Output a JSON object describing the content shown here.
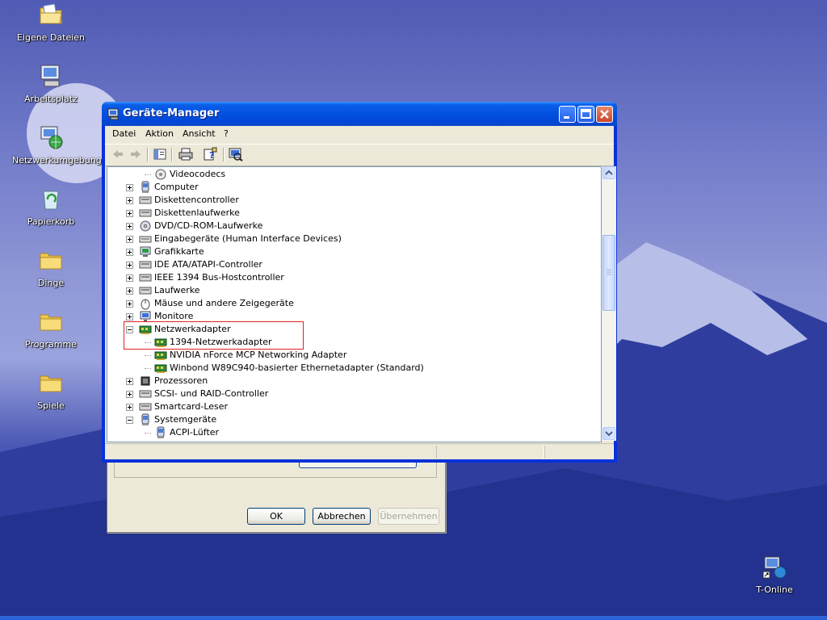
{
  "desktop": {
    "icons": [
      {
        "label": "Eigene Dateien",
        "icon": "my-documents-icon"
      },
      {
        "label": "Arbeitsplatz",
        "icon": "my-computer-icon"
      },
      {
        "label": "Netzwerkumgebung",
        "icon": "network-places-icon"
      },
      {
        "label": "Papierkorb",
        "icon": "recycle-bin-icon"
      },
      {
        "label": "Dinge",
        "icon": "folder-icon"
      },
      {
        "label": "Programme",
        "icon": "folder-icon"
      },
      {
        "label": "Spiele",
        "icon": "folder-icon"
      },
      {
        "label": "T-Online",
        "icon": "t-online-shortcut-icon"
      }
    ]
  },
  "background_dialog": {
    "ok_label": "OK",
    "cancel_label": "Abbrechen",
    "apply_label": "Übernehmen"
  },
  "window": {
    "title": "Geräte-Manager",
    "menu": [
      "Datei",
      "Aktion",
      "Ansicht",
      "?"
    ],
    "toolbar_icons": [
      "back-arrow-icon",
      "forward-arrow-icon",
      "show-hide-tree-icon",
      "print-icon",
      "properties-help-icon",
      "scan-hardware-icon"
    ]
  },
  "tree": [
    {
      "label": "Videocodecs",
      "level": 1,
      "icon": "codec-icon"
    },
    {
      "label": "Computer",
      "level": 0,
      "expander": "+",
      "icon": "computer-icon"
    },
    {
      "label": "Diskettencontroller",
      "level": 0,
      "expander": "+",
      "icon": "floppy-controller-icon"
    },
    {
      "label": "Diskettenlaufwerke",
      "level": 0,
      "expander": "+",
      "icon": "floppy-drive-icon"
    },
    {
      "label": "DVD/CD-ROM-Laufwerke",
      "level": 0,
      "expander": "+",
      "icon": "cdrom-icon"
    },
    {
      "label": "Eingabegeräte (Human Interface Devices)",
      "level": 0,
      "expander": "+",
      "icon": "hid-icon"
    },
    {
      "label": "Grafikkarte",
      "level": 0,
      "expander": "+",
      "icon": "display-adapter-icon"
    },
    {
      "label": "IDE ATA/ATAPI-Controller",
      "level": 0,
      "expander": "+",
      "icon": "ide-controller-icon"
    },
    {
      "label": "IEEE 1394 Bus-Hostcontroller",
      "level": 0,
      "expander": "+",
      "icon": "ieee1394-icon"
    },
    {
      "label": "Laufwerke",
      "level": 0,
      "expander": "+",
      "icon": "disk-drive-icon"
    },
    {
      "label": "Mäuse und andere Zeigegeräte",
      "level": 0,
      "expander": "+",
      "icon": "mouse-icon"
    },
    {
      "label": "Monitore",
      "level": 0,
      "expander": "+",
      "icon": "monitor-icon"
    },
    {
      "label": "Netzwerkadapter",
      "level": 0,
      "expander": "-",
      "icon": "network-adapter-icon"
    },
    {
      "label": "1394-Netzwerkadapter",
      "level": 1,
      "icon": "network-adapter-icon"
    },
    {
      "label": "NVIDIA nForce MCP Networking Adapter",
      "level": 1,
      "icon": "network-adapter-icon"
    },
    {
      "label": "Winbond W89C940-basierter Ethernetadapter (Standard)",
      "level": 1,
      "icon": "network-adapter-icon"
    },
    {
      "label": "Prozessoren",
      "level": 0,
      "expander": "+",
      "icon": "processor-icon"
    },
    {
      "label": "SCSI- und RAID-Controller",
      "level": 0,
      "expander": "+",
      "icon": "scsi-controller-icon"
    },
    {
      "label": "Smartcard-Leser",
      "level": 0,
      "expander": "+",
      "icon": "smartcard-reader-icon"
    },
    {
      "label": "Systemgeräte",
      "level": 0,
      "expander": "-",
      "icon": "system-devices-icon"
    },
    {
      "label": "ACPI-Lüfter",
      "level": 1,
      "icon": "system-device-icon"
    }
  ],
  "colors": {
    "titlebar": "#0554e3",
    "highlight_box": "#e52020",
    "window_face": "#ece9d8"
  }
}
